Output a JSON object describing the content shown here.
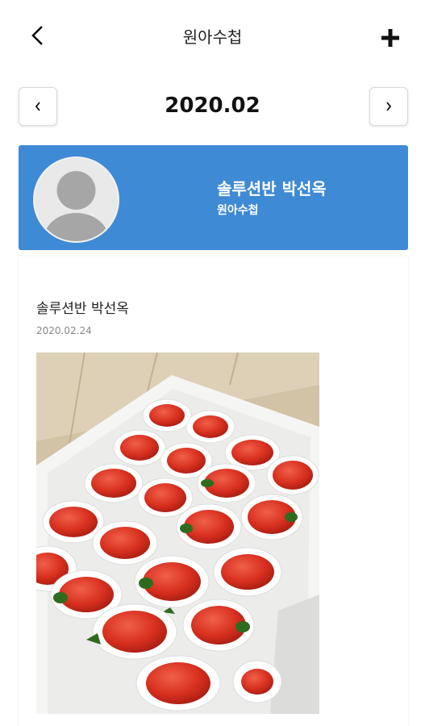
{
  "header": {
    "title": "원아수첩",
    "back_icon": "chevron-left-icon",
    "add_icon": "plus-icon"
  },
  "month_nav": {
    "label": "2020.02",
    "prev_icon": "chevron-left-icon",
    "next_icon": "chevron-right-icon"
  },
  "profile": {
    "name": "솔루션반 박선옥",
    "role": "원아수첩",
    "banner_color": "#3f8ad4",
    "avatar_icon": "default-avatar-icon"
  },
  "post": {
    "author": "솔루션반 박선옥",
    "date": "2020.02.24",
    "photo": "box-of-strawberries-photo"
  }
}
